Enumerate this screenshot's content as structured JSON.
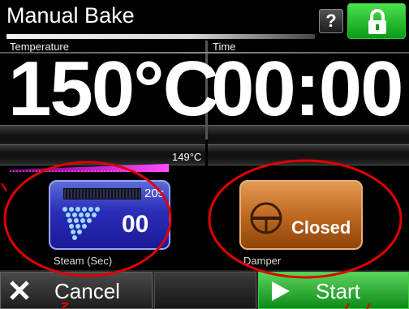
{
  "header": {
    "title": "Manual Bake",
    "help_label": "?",
    "lock_icon": "lock-icon"
  },
  "temperature": {
    "label": "Temperature",
    "setpoint": "150°C",
    "actual": "149°C"
  },
  "time": {
    "label": "Time",
    "value": "00:00"
  },
  "steam": {
    "seconds_label": "20s",
    "value": "00",
    "caption": "Steam (Sec)",
    "icon": "steam-icon"
  },
  "damper": {
    "value": "Closed",
    "caption": "Damper",
    "icon": "damper-icon"
  },
  "footer": {
    "cancel_label": "Cancel",
    "start_label": "Start"
  },
  "colors": {
    "steam_button": "#2a2db8",
    "damper_button": "#c06a22",
    "start_button": "#0e8a1a",
    "lock_button": "#0a9a17",
    "annotation": "#e00000"
  }
}
